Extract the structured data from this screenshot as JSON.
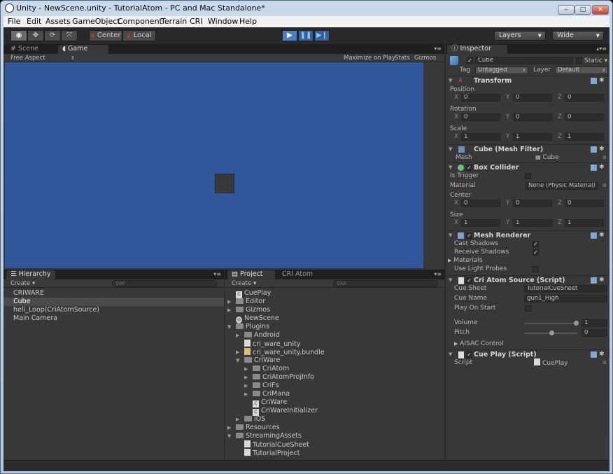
{
  "window": {
    "title": "Unity - NewScene.unity - TutorialAtom - PC and Mac Standalone*",
    "minimize": "‒",
    "maximize": "□",
    "close": "✕"
  },
  "menu": [
    "File",
    "Edit",
    "Assets",
    "GameObject",
    "Component",
    "Terrain",
    "CRI",
    "Window",
    "Help"
  ],
  "toolbar": {
    "pivot": "Center",
    "space": "Local",
    "layers": "Layers",
    "layout": "Wide"
  },
  "scene_panel": {
    "tabs": [
      "Scene",
      "Game"
    ],
    "aspect": "Free Aspect",
    "maximize_on_play": "Maximize on Play",
    "stats": "Stats",
    "gizmos": "Gizmos",
    "background_color": "#31569a"
  },
  "hierarchy": {
    "tab": "Hierarchy",
    "create": "Create",
    "search_placeholder": "All",
    "items": [
      "CRIWARE",
      "Cube",
      "heli_Loop(CriAtomSource)",
      "Main Camera"
    ]
  },
  "project": {
    "tabs": [
      "Project",
      "CRI Atom"
    ],
    "create": "Create",
    "search_placeholder": "All",
    "items": [
      {
        "label": "CuePlay",
        "depth": 0,
        "kind": "script"
      },
      {
        "label": "Editor",
        "depth": 0,
        "kind": "folder",
        "state": "closed"
      },
      {
        "label": "Gizmos",
        "depth": 0,
        "kind": "folder",
        "state": "closed"
      },
      {
        "label": "NewScene",
        "depth": 0,
        "kind": "scene"
      },
      {
        "label": "Plugins",
        "depth": 0,
        "kind": "folder",
        "state": "open"
      },
      {
        "label": "Android",
        "depth": 1,
        "kind": "folder",
        "state": "closed"
      },
      {
        "label": "cri_ware_unity",
        "depth": 1,
        "kind": "file"
      },
      {
        "label": "cri_ware_unity.bundle",
        "depth": 1,
        "kind": "bundle",
        "state": "closed"
      },
      {
        "label": "CriWare",
        "depth": 1,
        "kind": "folder",
        "state": "open"
      },
      {
        "label": "CriAtom",
        "depth": 2,
        "kind": "folder",
        "state": "closed"
      },
      {
        "label": "CriAtomProjInfo",
        "depth": 2,
        "kind": "folder",
        "state": "closed"
      },
      {
        "label": "CriFs",
        "depth": 2,
        "kind": "folder",
        "state": "closed"
      },
      {
        "label": "CriMana",
        "depth": 2,
        "kind": "folder",
        "state": "closed"
      },
      {
        "label": "CriWare",
        "depth": 2,
        "kind": "script"
      },
      {
        "label": "CriWareInitializer",
        "depth": 2,
        "kind": "script"
      },
      {
        "label": "iOS",
        "depth": 1,
        "kind": "folder",
        "state": "closed"
      },
      {
        "label": "Resources",
        "depth": 0,
        "kind": "folder",
        "state": "closed"
      },
      {
        "label": "StreamingAssets",
        "depth": 0,
        "kind": "folder",
        "state": "open"
      },
      {
        "label": "TutorialCueSheet",
        "depth": 1,
        "kind": "file"
      },
      {
        "label": "TutorialProject",
        "depth": 1,
        "kind": "file"
      }
    ]
  },
  "inspector": {
    "tab": "Inspector",
    "object_name": "Cube",
    "static_label": "Static",
    "tag_label": "Tag",
    "tag_value": "Untagged",
    "layer_label": "Layer",
    "layer_value": "Default",
    "transform": {
      "title": "Transform",
      "position_label": "Position",
      "rotation_label": "Rotation",
      "scale_label": "Scale",
      "axes": [
        "X",
        "Y",
        "Z"
      ],
      "position": [
        "0",
        "0",
        "0"
      ],
      "rotation": [
        "0",
        "0",
        "0"
      ],
      "scale": [
        "1",
        "1",
        "1"
      ]
    },
    "mesh_filter": {
      "title": "Cube (Mesh Filter)",
      "mesh_label": "Mesh",
      "mesh_value": "Cube"
    },
    "box_collider": {
      "title": "Box Collider",
      "is_trigger_label": "Is Trigger",
      "material_label": "Material",
      "material_value": "None (Physic Material)",
      "center_label": "Center",
      "center": [
        "0",
        "0",
        "0"
      ],
      "size_label": "Size",
      "size": [
        "1",
        "1",
        "1"
      ]
    },
    "mesh_renderer": {
      "title": "Mesh Renderer",
      "cast_shadows_label": "Cast Shadows",
      "receive_shadows_label": "Receive Shadows",
      "materials_label": "Materials",
      "light_probes_label": "Use Light Probes"
    },
    "cri_atom_source": {
      "title": "Cri Atom Source (Script)",
      "cue_sheet_label": "Cue Sheet",
      "cue_sheet_value": "TutorialCueSheet",
      "cue_name_label": "Cue Name",
      "cue_name_value": "gun1_High",
      "play_on_start_label": "Play On Start",
      "volume_label": "Volume",
      "volume_value": "1",
      "pitch_label": "Pitch",
      "pitch_value": "0",
      "aisac_label": "AISAC Control"
    },
    "cue_play": {
      "title": "Cue Play (Script)",
      "script_label": "Script",
      "script_value": "CuePlay"
    }
  }
}
